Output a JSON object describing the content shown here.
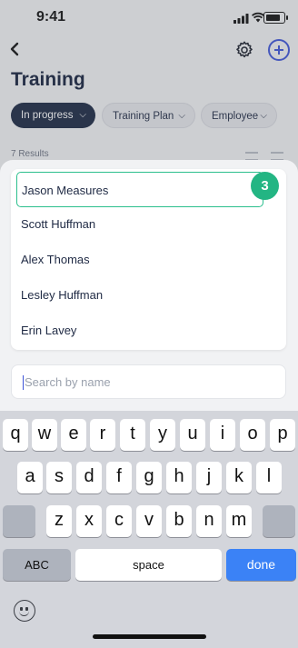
{
  "status_bar": {
    "time": "9:41"
  },
  "header": {
    "back_icon": "chevron-left-icon",
    "settings_icon": "gear-icon",
    "add_icon": "plus-circle-icon",
    "accent": "#3d54d9"
  },
  "page": {
    "title": "Training"
  },
  "filters": [
    {
      "label": "In progress",
      "active": true
    },
    {
      "label": "Training Plan",
      "active": false
    },
    {
      "label": "Employee",
      "active": false
    }
  ],
  "results": {
    "count_text": "7 Results"
  },
  "picker": {
    "items": [
      "Jason Measures",
      "Scott Huffman",
      "Alex Thomas",
      "Lesley Huffman",
      "Erin Lavey"
    ],
    "selected_index": 0,
    "badge": "3",
    "badge_color": "#23b583"
  },
  "search": {
    "placeholder": "Search by name",
    "value": ""
  },
  "keyboard": {
    "row1": [
      "q",
      "w",
      "e",
      "r",
      "t",
      "y",
      "u",
      "i",
      "o",
      "p"
    ],
    "row2": [
      "a",
      "s",
      "d",
      "f",
      "g",
      "h",
      "j",
      "k",
      "l"
    ],
    "row3": [
      "z",
      "x",
      "c",
      "v",
      "b",
      "n",
      "m"
    ],
    "abc_label": "ABC",
    "space_label": "space",
    "done_label": "done",
    "done_color": "#3b82f6"
  }
}
